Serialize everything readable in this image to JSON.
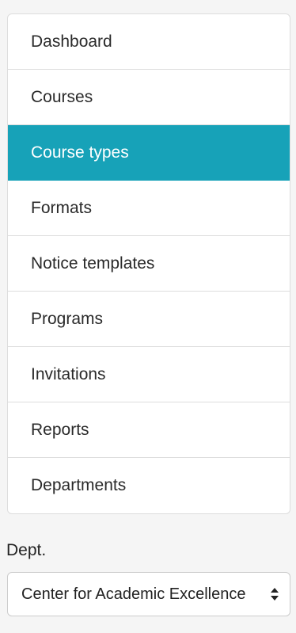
{
  "nav": {
    "items": [
      {
        "label": "Dashboard"
      },
      {
        "label": "Courses"
      },
      {
        "label": "Course types"
      },
      {
        "label": "Formats"
      },
      {
        "label": "Notice templates"
      },
      {
        "label": "Programs"
      },
      {
        "label": "Invitations"
      },
      {
        "label": "Reports"
      },
      {
        "label": "Departments"
      }
    ],
    "active_label": "Course types",
    "accent_color": "#17a2b8"
  },
  "dept": {
    "label": "Dept.",
    "selected": "Center for Academic Excellence",
    "icon": "updown-chevron-icon"
  }
}
